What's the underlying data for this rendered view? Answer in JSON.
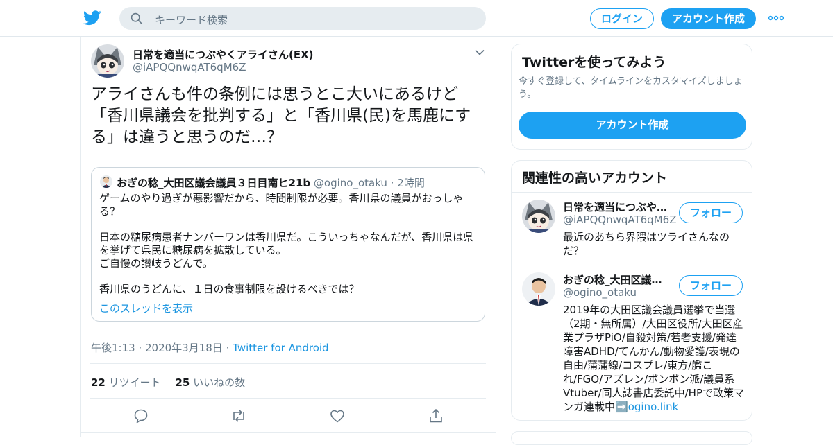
{
  "header": {
    "search_placeholder": "キーワード検索",
    "login_label": "ログイン",
    "signup_label": "アカウント作成",
    "brand_color": "#1da1f2"
  },
  "tweet": {
    "author_name": "日常を適当につぶやくアライさん(EX)",
    "author_handle": "@iAPQQnwqAT6qM6Z",
    "text": "アライさんも件の条例には思うとこ大いにあるけど「香川県議会を批判する」と「香川県(民)を馬鹿にする」は違うと思うのだ…？",
    "quote": {
      "author_name": "おぎの稔_大田区議会議員３日目南ヒ21b",
      "author_handle": "@ogino_otaku",
      "separator": "·",
      "time": "2時間",
      "paragraphs": [
        "ゲームのやり過ぎが悪影響だから、時間制限が必要。香川県の議員がおっしゃる？",
        "日本の糖尿病患者ナンバーワンは香川県だ。こういっちゃなんだが、香川県は県を挙げて県民に糖尿病を拡散している。\nご自慢の讃岐うどんで。",
        "香川県のうどんに、１日の食事制限を設けるべきでは？"
      ],
      "thread_link": "このスレッドを表示"
    },
    "timestamp": "午後1:13 · 2020年3月18日",
    "meta_separator": "·",
    "source": "Twitter for Android",
    "retweet_count": "22",
    "retweet_label": "リツイート",
    "like_count": "25",
    "like_label": "いいねの数",
    "actions": [
      "reply-icon",
      "retweet-icon",
      "like-icon",
      "share-icon"
    ]
  },
  "sidebar": {
    "try_card": {
      "title": "Twitterを使ってみよう",
      "subtitle": "今すぐ登録して、タイムラインをカスタマイズしましょう。",
      "button_label": "アカウント作成"
    },
    "related": {
      "title": "関連性の高いアカウント",
      "follow_label": "フォロー",
      "accounts": [
        {
          "name": "日常を適当につぶやくアライさん(EX)",
          "handle": "@iAPQQnwqAT6qM6Z",
          "bio": "最近のあちら界隈はツライさんなのだ？"
        },
        {
          "name": "おぎの稔_大田区議会議員３日目南ヒ21b",
          "handle": "@ogino_otaku",
          "bio": "2019年の大田区議会議員選挙で当選（2期・無所属）/大田区役所/大田区産業プラザPiO/自殺対策/若者支援/発達障害ADHD/てんかん/動物愛護/表現の自由/蒲蒲線/コスプレ/東方/艦これ/FGO/アズレン/ボンボン派/議員系Vtuber/同人誌書店委託中/HPで政策マンガ連載中",
          "bio_emoji": "➡️",
          "bio_link": "ogino.link"
        }
      ]
    }
  }
}
